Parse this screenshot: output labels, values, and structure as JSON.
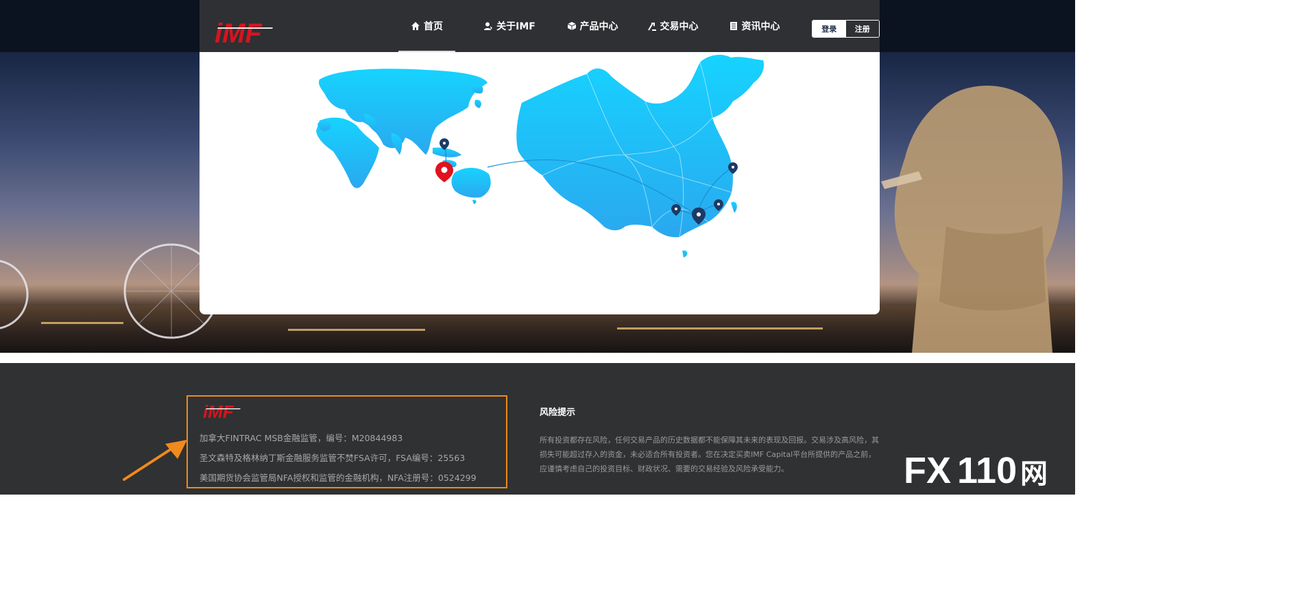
{
  "header": {
    "logo_text": "iMF",
    "nav": [
      {
        "label": "首页",
        "icon": "home-icon",
        "active": true
      },
      {
        "label": "关于IMF",
        "icon": "user-icon",
        "active": false
      },
      {
        "label": "产品中心",
        "icon": "cube-icon",
        "active": false
      },
      {
        "label": "交易中心",
        "icon": "trade-icon",
        "active": false
      },
      {
        "label": "资讯中心",
        "icon": "document-icon",
        "active": false
      }
    ],
    "login_label": "登录",
    "register_label": "注册"
  },
  "footer": {
    "logo_text": "iMF",
    "regulation": [
      "加拿大FINTRAC MSB金融监管，编号：M20844983",
      "圣文森特及格林纳丁斯金融服务监管不焚FSA许可，FSA编号：25563",
      "美国期货协会监管局NFA授权和监管的金融机构，NFA注册号：0524299"
    ],
    "risk_title": "风险提示",
    "risk_text": "所有投资都存在风险，任何交易产品的历史数据都不能保障其未来的表现及回报。交易涉及高风险，其损失可能超过存入的资金，未必适合所有投资者。您在决定买卖IMF Capital平台所提供的产品之前，应谨慎考虑自己的投资目标、财政状况、需要的交易经验及风险承受能力。"
  },
  "watermark": {
    "fx": "FX",
    "num": "110",
    "suffix": "网"
  },
  "colors": {
    "header_bg": "#2f3033",
    "map_blue": "#1cc4f4",
    "accent_orange": "#f08a1d",
    "pin_red": "#e0121d",
    "pin_navy": "#1d3a66"
  }
}
